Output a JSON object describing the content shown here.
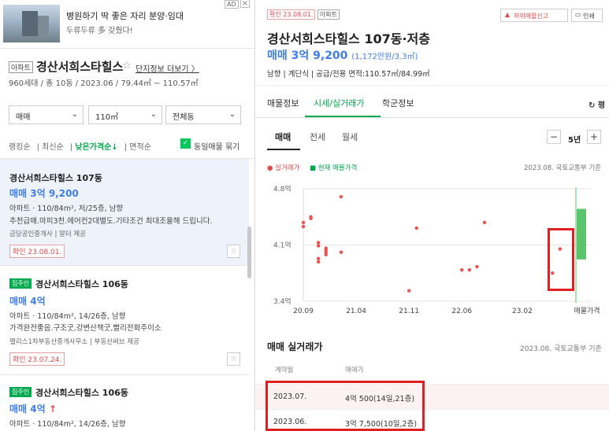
{
  "ad": {
    "badge": "AD",
    "close": "×",
    "line1": "병원하기 딱 좋은 자리 분양·임대",
    "line2": "두류두류 多 갖췄다!"
  },
  "complex": {
    "type": "아파트",
    "name": "경산서희스타힐스",
    "more": "단지정보 더보기",
    "info": "960세대 / 총 10동 / 2023.06 / 79.44㎡ ~ 110.57㎡"
  },
  "filters": {
    "trade": "매매",
    "area": "110㎡",
    "building": "전체동"
  },
  "sorts": [
    "랭킹순",
    "최신순",
    "낮은가격순↓",
    "면적순"
  ],
  "same_listing_label": "동일매물 묶기",
  "listings": [
    {
      "title": "경산서희스타힐스 107동",
      "price": "매매 3억 9,200",
      "spec": "아파트 · 110/84m², 저/25층, 남향",
      "desc": "추천급매.마피3천.에어컨2대별도.기타조건 최대조율해 드립니다.",
      "agent": "금당공인중개사 | 알터 제공",
      "confirm": "확인 23.08.01."
    },
    {
      "badge": "집주인",
      "title": "경산서희스타힐스 106동",
      "price": "매매 4억",
      "spec": "아파트 · 110/84m², 14/26층, 남향",
      "desc": "가격완전좋음.구조굿,강변산책굿,빨리전화주이소",
      "agent": "펠리스1차부동산중개사무소 | 부동산써브 제공",
      "confirm": "확인 23.07.24."
    },
    {
      "badge": "집주인",
      "title": "경산서희스타힐스 106동",
      "price": "매매 4억",
      "price_arrow": "↑",
      "spec": "아파트 · 110/84m², 14/26층, 남향"
    }
  ],
  "detail": {
    "confirm_tag": "확인 23.08.01.",
    "type_tag": "아파트",
    "report_btn": "허위매물신고",
    "print_btn": "인쇄",
    "title": "경산서희스타힐스 107동·저층",
    "price": "매매 3억 9,200",
    "price_sub": "(1,172만원/3.3㎡)",
    "info": "남향 | 계단식 | 공급/전용 면적:110.57㎡/84.99㎡",
    "tabs": [
      "매물정보",
      "시세/실거래가",
      "학군정보"
    ],
    "refresh": "↻ 평",
    "subtabs": [
      "매매",
      "전세",
      "월세"
    ],
    "period": "5년",
    "minus": "−",
    "plus": "+",
    "legend_actual": "● 실거래가",
    "legend_current": "■ 현재 매물가격",
    "source": "2023.08. 국토교통부 기준",
    "section_title": "매매 실거래가",
    "section_source": "2023.08. 국토교통부 기준",
    "col_date": "계약월",
    "col_price": "매매가",
    "rows": [
      {
        "date": "2023.07.",
        "price": "4억 500(14일,21층)"
      },
      {
        "date": "2023.06.",
        "price": "3억 7,500(10일,2층)"
      }
    ]
  },
  "chart_data": {
    "type": "scatter",
    "y_tick_labels": [
      "4.8억",
      "4.1억",
      "3.4억"
    ],
    "x_tick_labels": [
      "20.09",
      "21.04",
      "21.11",
      "22.06",
      "23.02",
      "매물가격"
    ],
    "ylim": [
      3.4,
      4.8
    ],
    "xlim": [
      "2020-09",
      "2023-09"
    ],
    "series": [
      {
        "name": "실거래가",
        "color": "#f05050",
        "points": [
          {
            "x": "2020-09",
            "y": 4.33
          },
          {
            "x": "2020-09",
            "y": 4.38
          },
          {
            "x": "2020-10",
            "y": 4.43
          },
          {
            "x": "2020-10",
            "y": 4.45
          },
          {
            "x": "2020-11",
            "y": 4.13
          },
          {
            "x": "2020-11",
            "y": 4.09
          },
          {
            "x": "2020-11",
            "y": 3.93
          },
          {
            "x": "2020-11",
            "y": 3.89
          },
          {
            "x": "2020-12",
            "y": 4.04
          },
          {
            "x": "2020-12",
            "y": 4.01
          },
          {
            "x": "2020-12",
            "y": 3.98
          },
          {
            "x": "2020-12",
            "y": 4.06
          },
          {
            "x": "2021-02",
            "y": 4.7
          },
          {
            "x": "2021-02",
            "y": 4.01
          },
          {
            "x": "2021-11",
            "y": 3.53
          },
          {
            "x": "2021-12",
            "y": 4.31
          },
          {
            "x": "2022-06",
            "y": 3.79
          },
          {
            "x": "2022-07",
            "y": 3.79
          },
          {
            "x": "2022-08",
            "y": 3.83
          },
          {
            "x": "2022-09",
            "y": 4.38
          },
          {
            "x": "2023-06",
            "y": 3.75
          },
          {
            "x": "2023-07",
            "y": 4.05
          }
        ]
      },
      {
        "name": "현재 매물가격",
        "color": "#5cc46a",
        "range": [
          3.92,
          4.55
        ]
      }
    ]
  }
}
